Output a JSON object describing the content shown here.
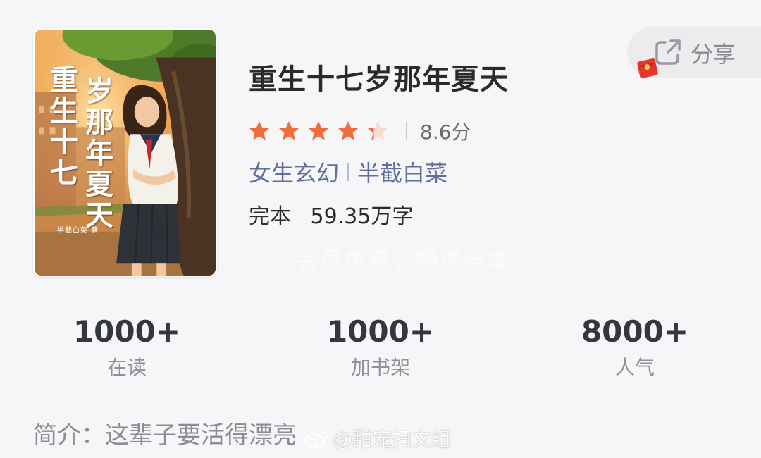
{
  "book": {
    "title": "重生十七岁那年夏天",
    "rating_value": 4.3,
    "rating_max": 5,
    "score_text": "8.6分",
    "category": "女生玄幻",
    "author": "半截白菜",
    "status": "完本",
    "word_count": "59.35万字"
  },
  "cover": {
    "title_col1": "重生十七",
    "title_col2": "岁那年夏天",
    "author_credit": "半截白菜 著"
  },
  "share": {
    "label": "分享",
    "icon": "share-icon",
    "badge_icon": "red-packet-icon"
  },
  "promo": {
    "text": "会员免费，畅读全本"
  },
  "metrics": [
    {
      "value": "1000+",
      "label": "在读"
    },
    {
      "value": "1000+",
      "label": "加书架"
    },
    {
      "value": "8000+",
      "label": "人气"
    }
  ],
  "intro": {
    "label": "简介：",
    "text": "这辈子要活得漂亮"
  },
  "watermark": {
    "text": "@甜宠扫文组",
    "icon": "weibo-icon"
  },
  "colors": {
    "star_filled": "#f26b3a",
    "star_empty": "#fbd9cf",
    "link": "#5e6f9c",
    "background": "#f6f6f8"
  }
}
